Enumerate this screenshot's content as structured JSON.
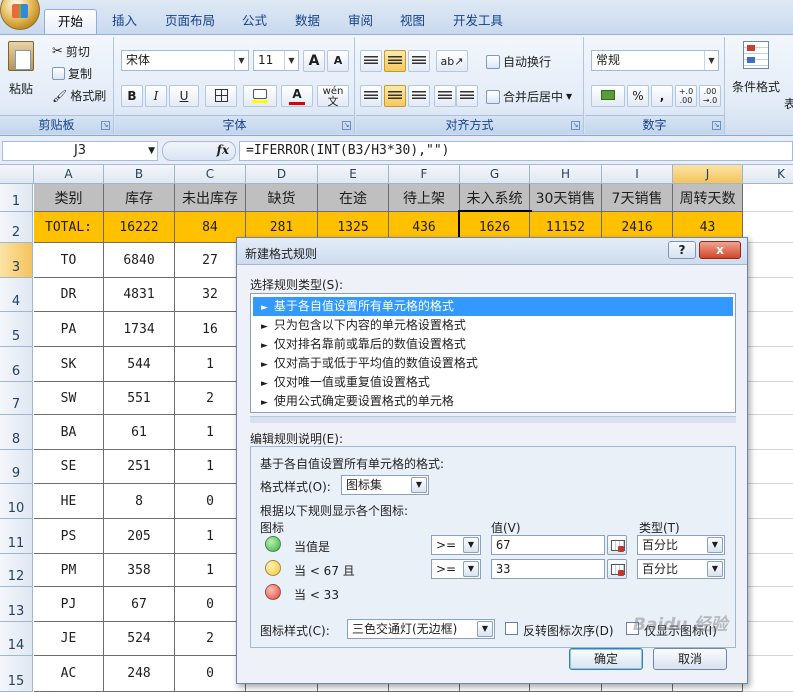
{
  "ribbon": {
    "tabs": [
      "开始",
      "插入",
      "页面布局",
      "公式",
      "数据",
      "审阅",
      "视图",
      "开发工具"
    ],
    "clipboard": {
      "paste": "粘贴",
      "cut": "剪切",
      "copy": "复制",
      "format_painter": "格式刷",
      "label": "剪贴板"
    },
    "font": {
      "name": "宋体",
      "size": "11",
      "label": "字体",
      "bold": "B",
      "italic": "I",
      "underline": "U",
      "grow": "A",
      "shrink": "A",
      "wen": "wén",
      "wen_char": "文"
    },
    "alignment": {
      "wrap": "自动换行",
      "merge": "合并后居中",
      "label": "对齐方式"
    },
    "number": {
      "format": "常规",
      "percent": "%",
      "comma": ",",
      "inc": "+.0\n.00",
      "dec": ".00\n→.0",
      "label": "数字"
    },
    "styles": {
      "conditional": "条件格式",
      "table": "表"
    }
  },
  "formula_bar": {
    "name_box": "J3",
    "fx": "fx",
    "formula": "=IFERROR(INT(B3/H3*30),\"\")"
  },
  "sheet": {
    "columns": [
      "A",
      "B",
      "C",
      "D",
      "E",
      "F",
      "G",
      "H",
      "I",
      "J",
      "K"
    ],
    "rows": [
      "1",
      "2",
      "3",
      "4",
      "5",
      "6",
      "7",
      "8",
      "9",
      "10",
      "11",
      "12",
      "13",
      "14",
      "15"
    ],
    "header": [
      "类别",
      "库存",
      "未出库存",
      "缺货",
      "在途",
      "待上架",
      "未入系统",
      "30天销售",
      "7天销售",
      "周转天数"
    ],
    "total": [
      "TOTAL:",
      "16222",
      "84",
      "281",
      "1325",
      "436",
      "1626",
      "11152",
      "2416",
      "43"
    ],
    "data": [
      [
        "TO",
        "6840",
        "27"
      ],
      [
        "DR",
        "4831",
        "32"
      ],
      [
        "PA",
        "1734",
        "16"
      ],
      [
        "SK",
        "544",
        "1"
      ],
      [
        "SW",
        "551",
        "2"
      ],
      [
        "BA",
        "61",
        "1"
      ],
      [
        "SE",
        "251",
        "1"
      ],
      [
        "HE",
        "8",
        "0"
      ],
      [
        "PS",
        "205",
        "1"
      ],
      [
        "PM",
        "358",
        "1"
      ],
      [
        "PJ",
        "67",
        "0"
      ],
      [
        "JE",
        "524",
        "2"
      ],
      [
        "AC",
        "248",
        "0"
      ]
    ]
  },
  "dialog": {
    "title": "新建格式规则",
    "help": "?",
    "close": "x",
    "select_rule_label": "选择规则类型(S):",
    "rules": [
      "基于各自值设置所有单元格的格式",
      "只为包含以下内容的单元格设置格式",
      "仅对排名靠前或靠后的数值设置格式",
      "仅对高于或低于平均值的数值设置格式",
      "仅对唯一值或重复值设置格式",
      "使用公式确定要设置格式的单元格"
    ],
    "edit_label": "编辑规则说明(E):",
    "desc_title": "基于各自值设置所有单元格的格式:",
    "format_style_label": "格式样式(O):",
    "format_style_value": "图标集",
    "display_label": "根据以下规则显示各个图标:",
    "col_icon": "图标",
    "col_value": "值(V)",
    "col_type": "类型(T)",
    "cond1_text": "当值是",
    "cond1_op": ">=",
    "cond1_value": "67",
    "cond1_type": "百分比",
    "cond2_text": "当 < 67 且",
    "cond2_op": ">=",
    "cond2_value": "33",
    "cond2_type": "百分比",
    "cond3_text": "当 < 33",
    "icon_style_label": "图标样式(C):",
    "icon_style_value": "三色交通灯(无边框)",
    "reverse_label": "反转图标次序(D)",
    "show_icon_only_label": "仅显示图标(I)",
    "ok": "确定",
    "cancel": "取消",
    "colors": {
      "green": "#3cb043",
      "yellow": "#f6c531",
      "red": "#e0453a"
    },
    "watermark": "Baidu 经验"
  }
}
